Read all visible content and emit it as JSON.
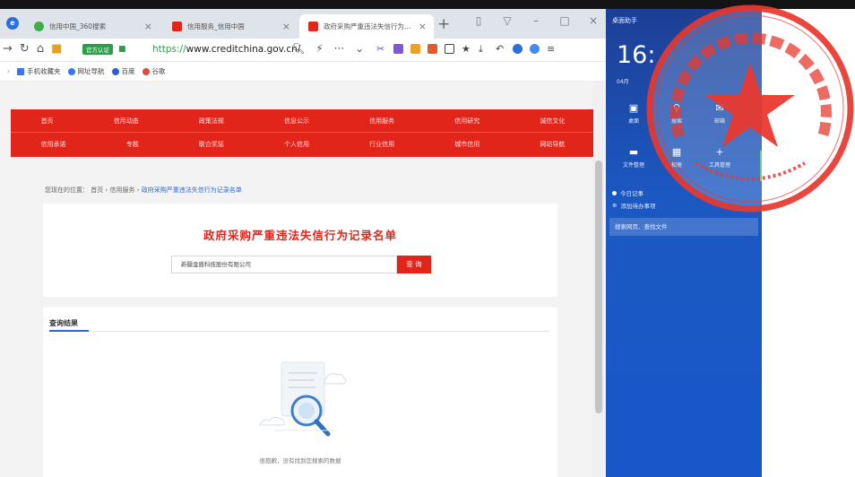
{
  "browser": {
    "tabs": [
      {
        "title": "信用中国_360搜索",
        "favicon_color": "#3fae49"
      },
      {
        "title": "信用服务_信用中国",
        "favicon_color": "#e1251b"
      },
      {
        "title": "政府采购严重违法失信行为记录名单",
        "favicon_color": "#e1251b"
      }
    ],
    "url_prefix": "https://",
    "url": "www.creditchina.gov.cn/",
    "address_tag": "官方认证",
    "bookmarks": [
      {
        "label": "手机收藏夹",
        "color": "#3478f6"
      },
      {
        "label": "网址导航",
        "color": "#3478f6"
      },
      {
        "label": "百度",
        "color": "#2b5fd9"
      },
      {
        "label": "谷歌",
        "color": "#e24a3b"
      }
    ]
  },
  "site": {
    "nav_row1": [
      "首页",
      "信用动态",
      "政策法规",
      "信息公示",
      "信用服务",
      "信用研究",
      "诚信文化"
    ],
    "nav_row2": [
      "信用承诺",
      "专题",
      "联合奖惩",
      "个人信用",
      "行业信用",
      "城市信用",
      "网站导航"
    ],
    "breadcrumb": {
      "label": "您现在的位置：",
      "items": [
        "首页",
        "信用服务"
      ],
      "current": "政府采购严重违法失信行为记录名单"
    },
    "search": {
      "title": "政府采购严重违法失信行为记录名单",
      "input_value": "新疆金盾科技股份有限公司",
      "button": "查 询"
    },
    "result": {
      "title": "查询结果",
      "empty_message": "很抱歉，没有找到您搜索的数据"
    }
  },
  "widget": {
    "title": "桌面助手",
    "time": "16:",
    "date": "04月",
    "tools": [
      {
        "label": "桌面",
        "icon": "monitor-icon"
      },
      {
        "label": "搜索",
        "icon": "search-icon"
      },
      {
        "label": "邮箱",
        "icon": "mail-icon"
      },
      {
        "label": "文件整理",
        "icon": "folder-icon"
      },
      {
        "label": "相册",
        "icon": "image-icon"
      },
      {
        "label": "工具管理",
        "icon": "plus-icon"
      }
    ],
    "list_item": "今日记事",
    "add_item": "添加待办事项",
    "search_placeholder": "搜索网页、查找文件"
  },
  "seal": {
    "text": "新疆金盾科技股份有限公司",
    "number": "6501040000000016",
    "color": "#e8392f"
  }
}
